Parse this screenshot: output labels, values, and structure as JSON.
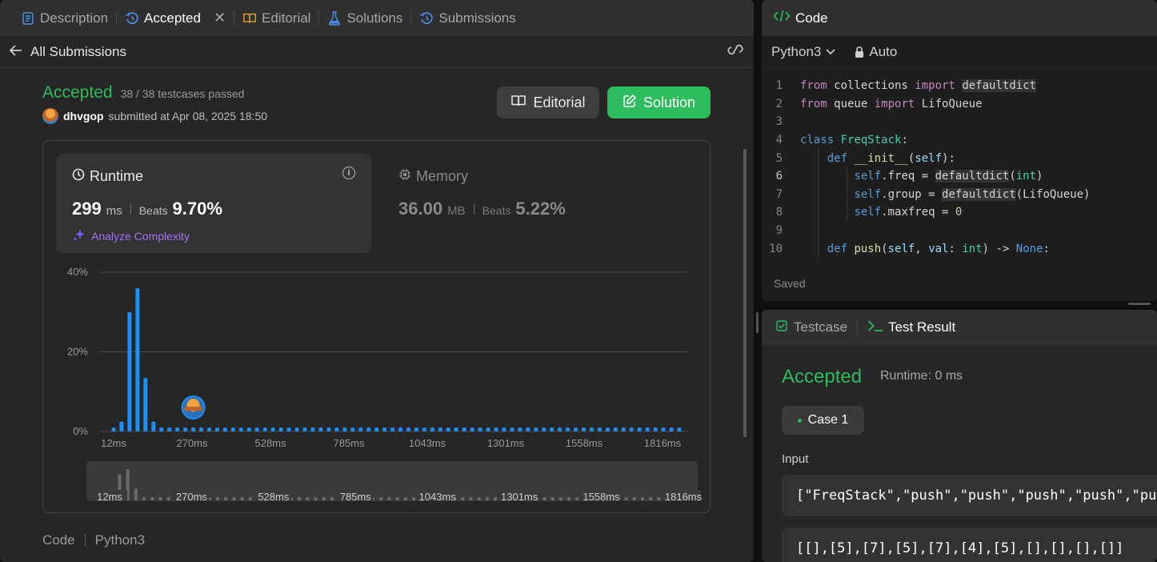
{
  "tabs": [
    {
      "label": "Description",
      "icon": "description-icon"
    },
    {
      "label": "Accepted",
      "icon": "history-icon"
    },
    {
      "label": "Editorial",
      "icon": "book-icon"
    },
    {
      "label": "Solutions",
      "icon": "flask-icon"
    },
    {
      "label": "Submissions",
      "icon": "history-icon"
    }
  ],
  "subheader": {
    "back_label": "All Submissions"
  },
  "result": {
    "status": "Accepted",
    "testcases": "38 / 38 testcases passed",
    "user": "dhvgop",
    "submitted_at": "submitted at Apr 08, 2025 18:50"
  },
  "buttons": {
    "editorial": "Editorial",
    "solution": "Solution"
  },
  "runtime": {
    "title": "Runtime",
    "value": "299",
    "unit": "ms",
    "beats_label": "Beats",
    "beats": "9.70%",
    "analyze": "Analyze Complexity"
  },
  "memory": {
    "title": "Memory",
    "value": "36.00",
    "unit": "MB",
    "beats_label": "Beats",
    "beats": "5.22%"
  },
  "chart_data": {
    "type": "bar",
    "y_ticks": [
      "40%",
      "20%",
      "0%"
    ],
    "ylim": [
      0,
      40
    ],
    "x_tick_labels": [
      "12ms",
      "270ms",
      "528ms",
      "785ms",
      "1043ms",
      "1301ms",
      "1558ms",
      "1816ms"
    ],
    "values": [
      1,
      2.5,
      30,
      36,
      13.5,
      2.5,
      1,
      1,
      1,
      1,
      1,
      1,
      1,
      1,
      1,
      1,
      1,
      1,
      1,
      1,
      1,
      1,
      1,
      1,
      1,
      1,
      1,
      1,
      1,
      1,
      1,
      1,
      1,
      1,
      1,
      1,
      1,
      1,
      1,
      1,
      1,
      1,
      1,
      1,
      1,
      1,
      1,
      1,
      1,
      1,
      1,
      1,
      1,
      1,
      1,
      1,
      1,
      1,
      1,
      1,
      1,
      1,
      1,
      1,
      1,
      1,
      1,
      1,
      1,
      1,
      1,
      1
    ],
    "your_bar_index": 10,
    "bar_color": "#1a90ff",
    "grid": true
  },
  "code_footer": {
    "label": "Code",
    "lang": "Python3"
  },
  "editor": {
    "title": "Code",
    "language": "Python3",
    "mode": "Auto",
    "saved": "Saved",
    "lines": [
      {
        "n": "1"
      },
      {
        "n": "2"
      },
      {
        "n": "3"
      },
      {
        "n": "4"
      },
      {
        "n": "5"
      },
      {
        "n": "6"
      },
      {
        "n": "7"
      },
      {
        "n": "8"
      },
      {
        "n": "9"
      },
      {
        "n": "10"
      }
    ]
  },
  "testresult": {
    "tab_testcase": "Testcase",
    "tab_result": "Test Result",
    "status": "Accepted",
    "runtime": "Runtime: 0 ms",
    "case": "Case 1",
    "input_label": "Input",
    "input_line1": "[\"FreqStack\",\"push\",\"push\",\"push\",\"push\",\"push\",\"pop\",\"pop\",\"pop\",\"pop\"]",
    "input_line2": "[[],[5],[7],[5],[7],[4],[5],[],[],[],[]]"
  },
  "colors": {
    "accent_green": "#2cbb5d",
    "bar_blue": "#1a90ff",
    "purple": "#a371f7"
  }
}
